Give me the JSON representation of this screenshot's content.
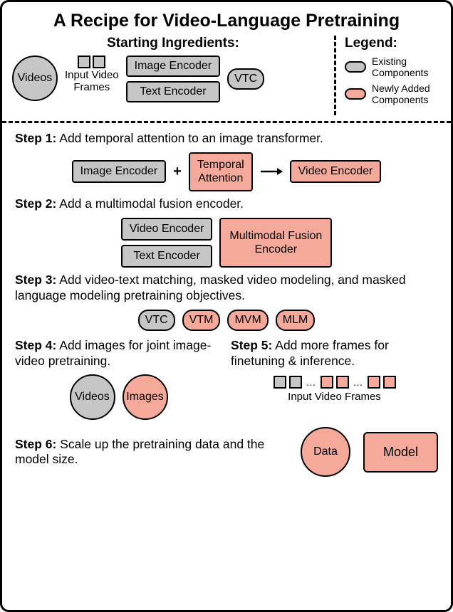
{
  "title": "A Recipe for Video-Language Pretraining",
  "ingredients": {
    "heading": "Starting Ingredients:",
    "videos": "Videos",
    "frames_label": "Input Video\nFrames",
    "image_encoder": "Image Encoder",
    "text_encoder": "Text Encoder",
    "vtc": "VTC"
  },
  "legend": {
    "heading": "Legend:",
    "existing": "Existing Components",
    "new": "Newly Added Components"
  },
  "step1": {
    "label": "Step 1:",
    "text": "Add temporal attention to an image transformer.",
    "image_encoder": "Image Encoder",
    "temporal": "Temporal\nAttention",
    "video_encoder": "Video Encoder"
  },
  "step2": {
    "label": "Step 2:",
    "text": "Add a multimodal fusion encoder.",
    "video_encoder": "Video Encoder",
    "text_encoder": "Text Encoder",
    "fusion": "Multimodal Fusion\nEncoder"
  },
  "step3": {
    "label": "Step 3:",
    "text": "Add video-text matching, masked video modeling, and masked language modeling pretraining objectives.",
    "vtc": "VTC",
    "vtm": "VTM",
    "mvm": "MVM",
    "mlm": "MLM"
  },
  "step4": {
    "label": "Step 4:",
    "text": "Add images for joint image-video pretraining.",
    "videos": "Videos",
    "images": "Images"
  },
  "step5": {
    "label": "Step 5:",
    "text": "Add more frames for finetuning & inference.",
    "frames_label": "Input Video Frames"
  },
  "step6": {
    "label": "Step 6:",
    "text": "Scale up the pretraining data and the model size.",
    "data": "Data",
    "model": "Model"
  },
  "colors": {
    "existing": "#c6c6c6",
    "new": "#f4a99a"
  }
}
